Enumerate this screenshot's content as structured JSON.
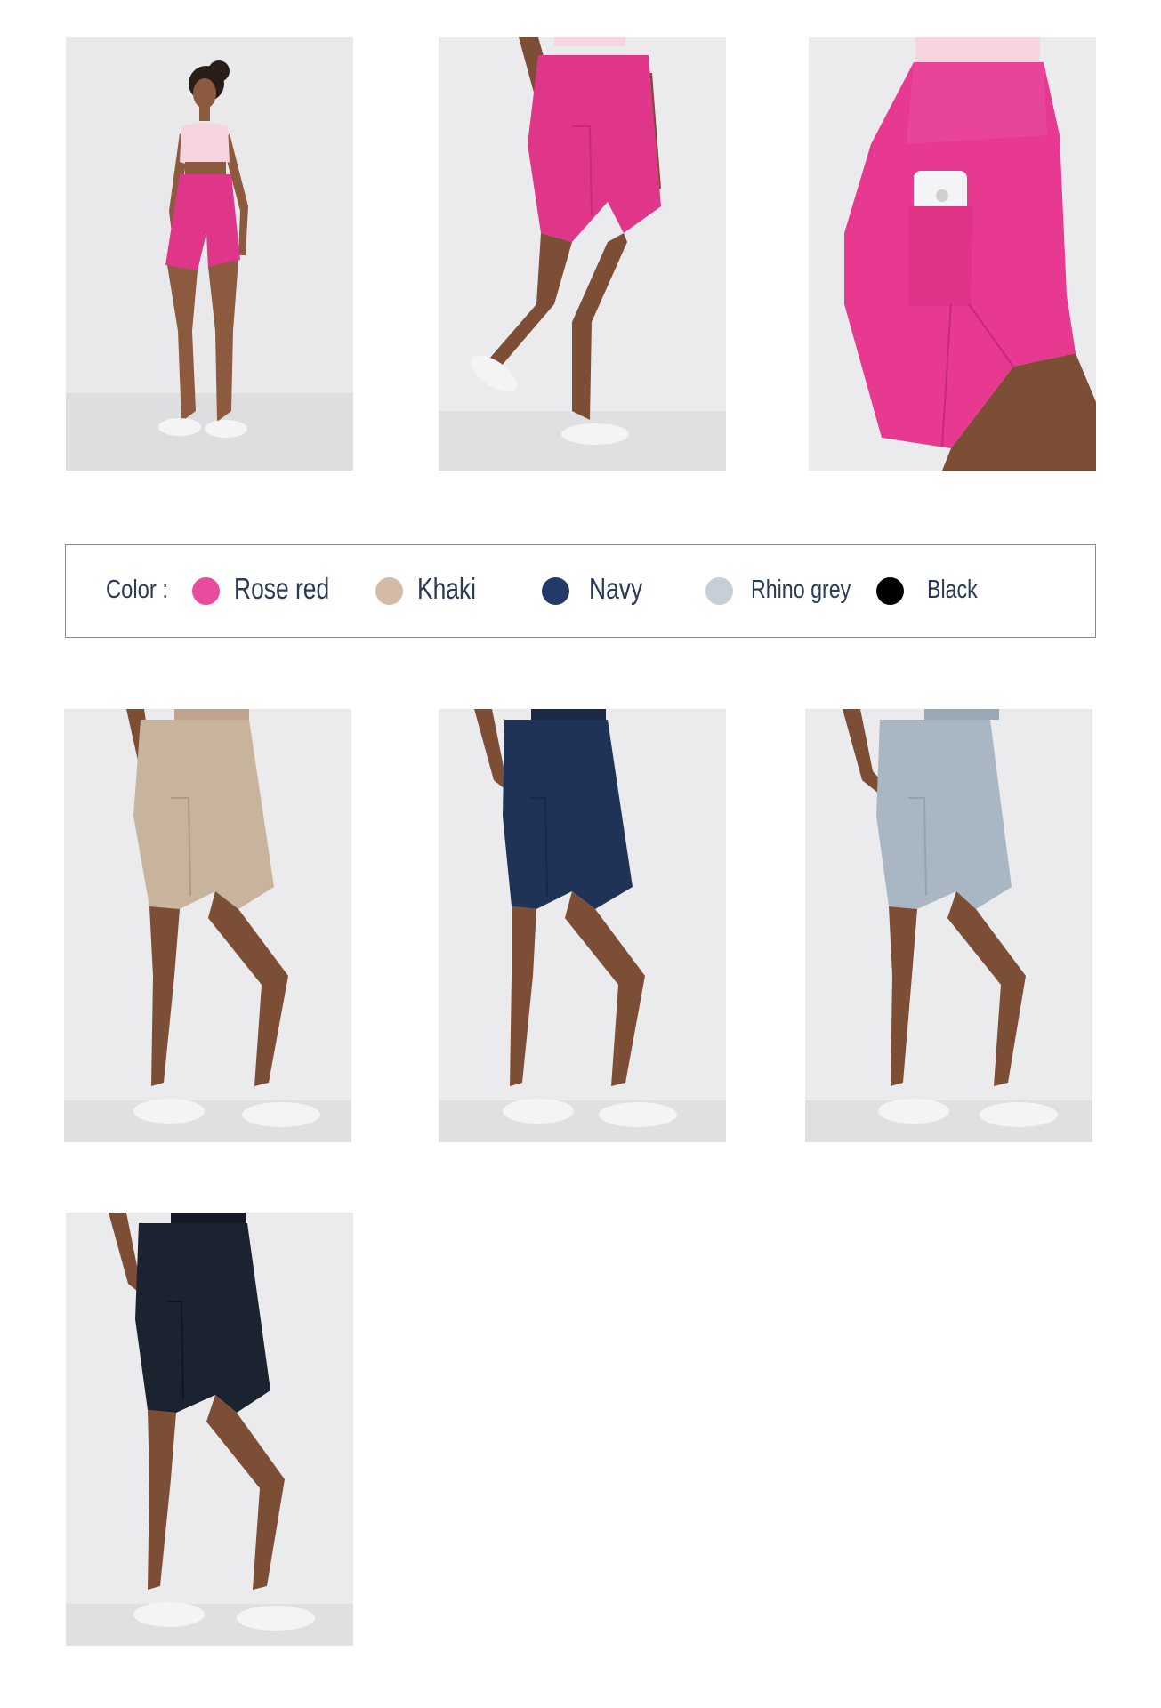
{
  "color_legend": {
    "label": "Color :",
    "options": [
      {
        "name": "Rose red",
        "swatch": "#ea4b9e"
      },
      {
        "name": "Khaki",
        "swatch": "#d4bba6"
      },
      {
        "name": "Navy",
        "swatch": "#233a68"
      },
      {
        "name": "Rhino grey",
        "swatch": "#c6cfd8"
      },
      {
        "name": "Black",
        "swatch": "#000000"
      }
    ]
  },
  "products": [
    {
      "variant": "Rose red",
      "view": "full-body-front",
      "color": "#e0368a"
    },
    {
      "variant": "Rose red",
      "view": "side-walking",
      "color": "#e0368a"
    },
    {
      "variant": "Rose red",
      "view": "pocket-closeup-with-phone",
      "color": "#e0368a"
    },
    {
      "variant": "Khaki",
      "view": "side",
      "color": "#c8b39d"
    },
    {
      "variant": "Navy",
      "view": "side",
      "color": "#1f3356"
    },
    {
      "variant": "Rhino grey",
      "view": "side",
      "color": "#a9b6c3"
    },
    {
      "variant": "Black",
      "view": "side",
      "color": "#1b2230"
    }
  ]
}
